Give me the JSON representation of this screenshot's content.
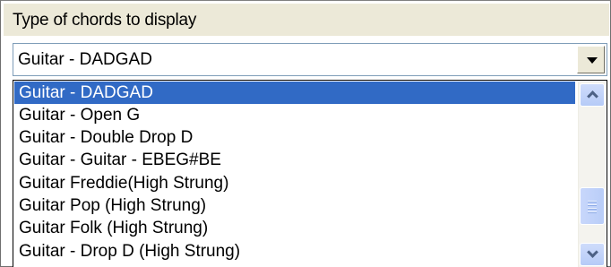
{
  "group": {
    "label": "Type of chords to display"
  },
  "select": {
    "value": "Guitar - DADGAD"
  },
  "dropdown": {
    "items": [
      {
        "label": "Guitar - DADGAD",
        "selected": true
      },
      {
        "label": "Guitar - Open G",
        "selected": false
      },
      {
        "label": "Guitar - Double Drop D",
        "selected": false
      },
      {
        "label": "Guitar - Guitar - EBEG#BE",
        "selected": false
      },
      {
        "label": "Guitar Freddie(High Strung)",
        "selected": false
      },
      {
        "label": "Guitar Pop (High Strung)",
        "selected": false
      },
      {
        "label": "Guitar Folk (High Strung)",
        "selected": false
      },
      {
        "label": "Guitar - Drop D (High Strung)",
        "selected": false
      }
    ]
  },
  "icons": {
    "dropdown_arrow": "chevron-down-icon",
    "scroll_up": "scroll-up-arrow-icon",
    "scroll_down": "scroll-down-arrow-icon",
    "scroll_thumb_grip": "grip-icon"
  },
  "colors": {
    "selection_bg": "#316ac5",
    "selection_text": "#ffffff",
    "label_bg": "#ece9d8"
  }
}
